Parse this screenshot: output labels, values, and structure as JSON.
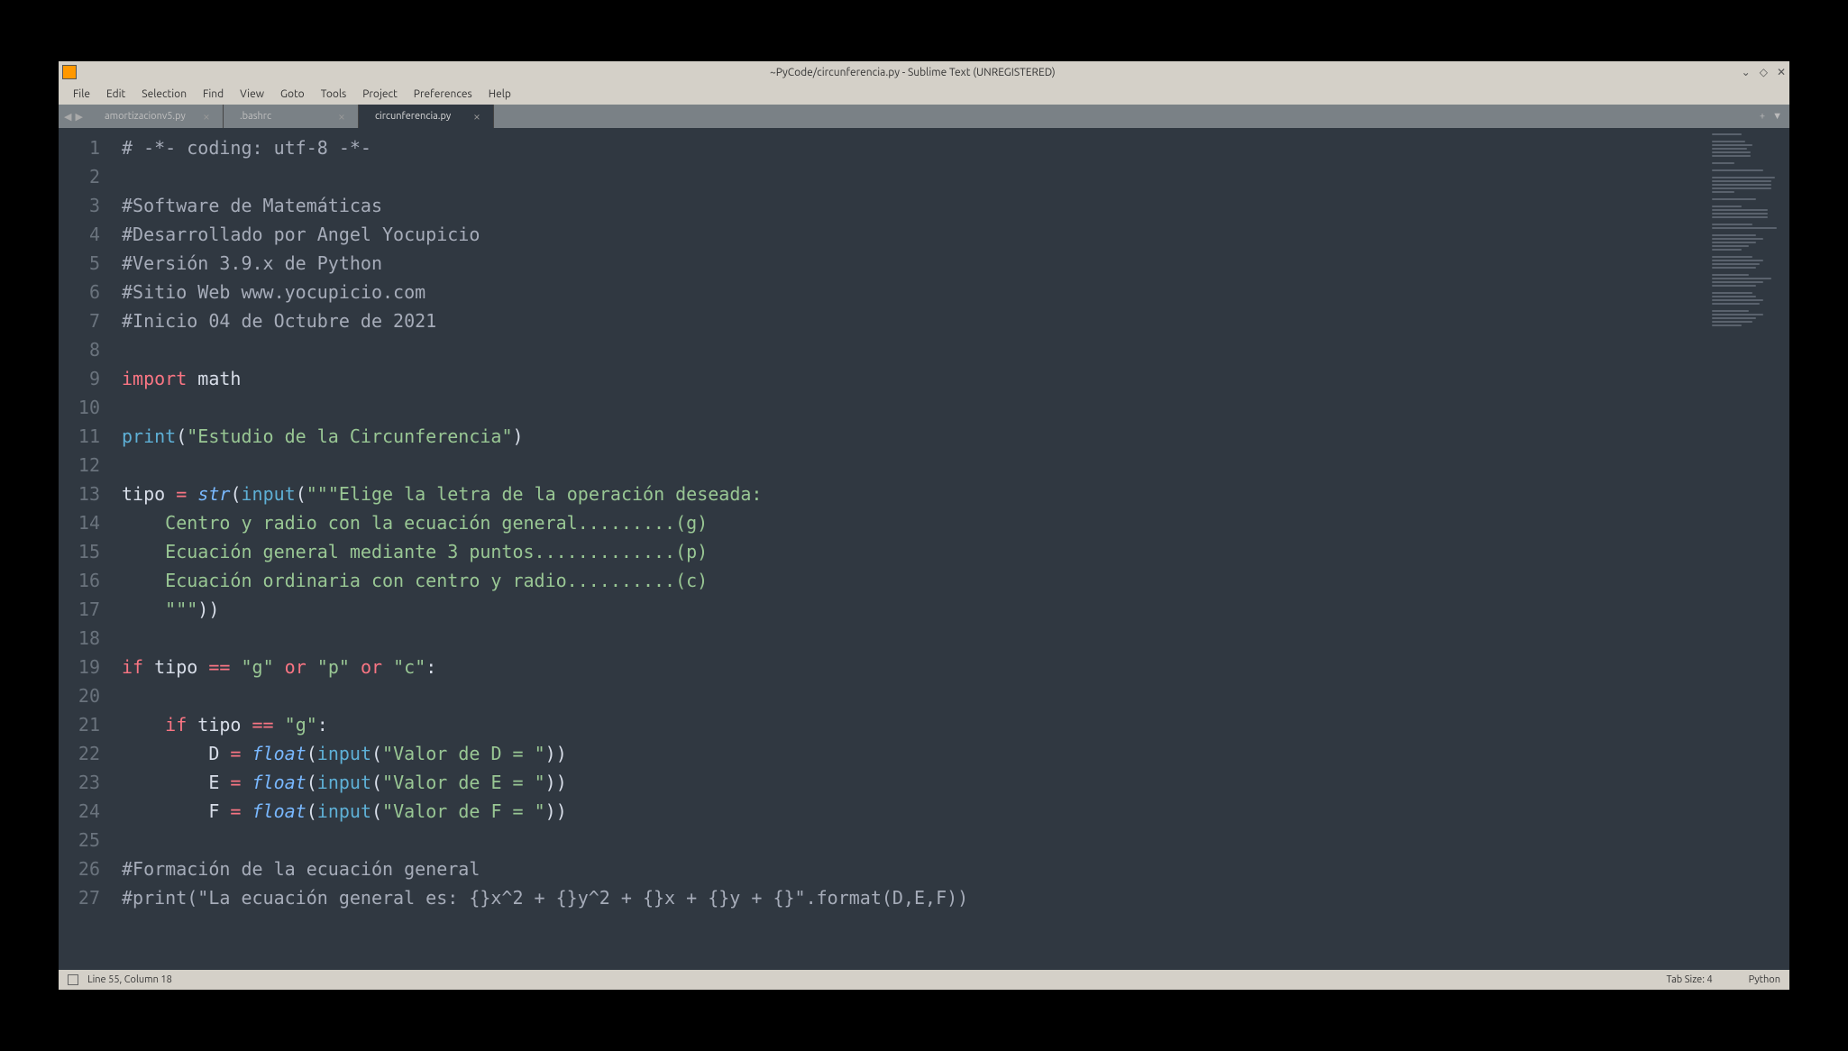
{
  "window": {
    "title": "~PyCode/circunferencia.py - Sublime Text (UNREGISTERED)"
  },
  "menu": {
    "items": [
      "File",
      "Edit",
      "Selection",
      "Find",
      "View",
      "Goto",
      "Tools",
      "Project",
      "Preferences",
      "Help"
    ]
  },
  "tabs": {
    "items": [
      {
        "label": "amortizacionv5.py",
        "active": false
      },
      {
        "label": ".bashrc",
        "active": false
      },
      {
        "label": "circunferencia.py",
        "active": true
      }
    ]
  },
  "statusbar": {
    "position": "Line 55, Column 18",
    "tab_size": "Tab Size: 4",
    "syntax": "Python"
  },
  "code": {
    "lines": [
      {
        "n": 1,
        "seg": [
          {
            "c": "comment",
            "t": "# -*- coding: utf-8 -*-"
          }
        ]
      },
      {
        "n": 2,
        "seg": []
      },
      {
        "n": 3,
        "seg": [
          {
            "c": "comment",
            "t": "#Software de Matemáticas"
          }
        ]
      },
      {
        "n": 4,
        "seg": [
          {
            "c": "comment",
            "t": "#Desarrollado por Angel Yocupicio"
          }
        ]
      },
      {
        "n": 5,
        "seg": [
          {
            "c": "comment",
            "t": "#Versión 3.9.x de Python"
          }
        ]
      },
      {
        "n": 6,
        "seg": [
          {
            "c": "comment",
            "t": "#Sitio Web www.yocupicio.com"
          }
        ]
      },
      {
        "n": 7,
        "seg": [
          {
            "c": "comment",
            "t": "#Inicio 04 de Octubre de 2021"
          }
        ]
      },
      {
        "n": 8,
        "seg": []
      },
      {
        "n": 9,
        "seg": [
          {
            "c": "kw",
            "t": "import"
          },
          {
            "c": "var",
            "t": " math"
          }
        ]
      },
      {
        "n": 10,
        "seg": []
      },
      {
        "n": 11,
        "seg": [
          {
            "c": "func",
            "t": "print"
          },
          {
            "c": "var",
            "t": "("
          },
          {
            "c": "string",
            "t": "\"Estudio de la Circunferencia\""
          },
          {
            "c": "var",
            "t": ")"
          }
        ]
      },
      {
        "n": 12,
        "seg": []
      },
      {
        "n": 13,
        "seg": [
          {
            "c": "var",
            "t": "tipo "
          },
          {
            "c": "op",
            "t": "="
          },
          {
            "c": "var",
            "t": " "
          },
          {
            "c": "builtin",
            "t": "str"
          },
          {
            "c": "var",
            "t": "("
          },
          {
            "c": "func",
            "t": "input"
          },
          {
            "c": "var",
            "t": "("
          },
          {
            "c": "string",
            "t": "\"\"\"Elige la letra de la operación deseada:"
          }
        ]
      },
      {
        "n": 14,
        "seg": [
          {
            "c": "string",
            "t": "    Centro y radio con la ecuación general.........(g)"
          }
        ]
      },
      {
        "n": 15,
        "seg": [
          {
            "c": "string",
            "t": "    Ecuación general mediante 3 puntos.............(p)"
          }
        ]
      },
      {
        "n": 16,
        "seg": [
          {
            "c": "string",
            "t": "    Ecuación ordinaria con centro y radio..........(c)"
          }
        ]
      },
      {
        "n": 17,
        "seg": [
          {
            "c": "string",
            "t": "    \"\"\""
          },
          {
            "c": "var",
            "t": "))"
          }
        ]
      },
      {
        "n": 18,
        "seg": []
      },
      {
        "n": 19,
        "seg": [
          {
            "c": "kw",
            "t": "if"
          },
          {
            "c": "var",
            "t": " tipo "
          },
          {
            "c": "op",
            "t": "=="
          },
          {
            "c": "var",
            "t": " "
          },
          {
            "c": "string",
            "t": "\"g\""
          },
          {
            "c": "var",
            "t": " "
          },
          {
            "c": "op",
            "t": "or"
          },
          {
            "c": "var",
            "t": " "
          },
          {
            "c": "string",
            "t": "\"p\""
          },
          {
            "c": "var",
            "t": " "
          },
          {
            "c": "op",
            "t": "or"
          },
          {
            "c": "var",
            "t": " "
          },
          {
            "c": "string",
            "t": "\"c\""
          },
          {
            "c": "var",
            "t": ":"
          }
        ]
      },
      {
        "n": 20,
        "seg": []
      },
      {
        "n": 21,
        "seg": [
          {
            "c": "var",
            "t": "    "
          },
          {
            "c": "kw",
            "t": "if"
          },
          {
            "c": "var",
            "t": " tipo "
          },
          {
            "c": "op",
            "t": "=="
          },
          {
            "c": "var",
            "t": " "
          },
          {
            "c": "string",
            "t": "\"g\""
          },
          {
            "c": "var",
            "t": ":"
          }
        ]
      },
      {
        "n": 22,
        "seg": [
          {
            "c": "var",
            "t": "        D "
          },
          {
            "c": "op",
            "t": "="
          },
          {
            "c": "var",
            "t": " "
          },
          {
            "c": "builtin",
            "t": "float"
          },
          {
            "c": "var",
            "t": "("
          },
          {
            "c": "func",
            "t": "input"
          },
          {
            "c": "var",
            "t": "("
          },
          {
            "c": "string",
            "t": "\"Valor de D = \""
          },
          {
            "c": "var",
            "t": "))"
          }
        ]
      },
      {
        "n": 23,
        "seg": [
          {
            "c": "var",
            "t": "        E "
          },
          {
            "c": "op",
            "t": "="
          },
          {
            "c": "var",
            "t": " "
          },
          {
            "c": "builtin",
            "t": "float"
          },
          {
            "c": "var",
            "t": "("
          },
          {
            "c": "func",
            "t": "input"
          },
          {
            "c": "var",
            "t": "("
          },
          {
            "c": "string",
            "t": "\"Valor de E = \""
          },
          {
            "c": "var",
            "t": "))"
          }
        ]
      },
      {
        "n": 24,
        "seg": [
          {
            "c": "var",
            "t": "        F "
          },
          {
            "c": "op",
            "t": "="
          },
          {
            "c": "var",
            "t": " "
          },
          {
            "c": "builtin",
            "t": "float"
          },
          {
            "c": "var",
            "t": "("
          },
          {
            "c": "func",
            "t": "input"
          },
          {
            "c": "var",
            "t": "("
          },
          {
            "c": "string",
            "t": "\"Valor de F = \""
          },
          {
            "c": "var",
            "t": "))"
          }
        ]
      },
      {
        "n": 25,
        "seg": []
      },
      {
        "n": 26,
        "seg": [
          {
            "c": "comment",
            "t": "#Formación de la ecuación general"
          }
        ]
      },
      {
        "n": 27,
        "seg": [
          {
            "c": "comment",
            "t": "#print(\"La ecuación general es: {}x^2 + {}y^2 + {}x + {}y + {}\".format(D,E,F))"
          }
        ]
      }
    ]
  },
  "minimap_widths": [
    40,
    0,
    45,
    55,
    48,
    52,
    52,
    0,
    30,
    0,
    70,
    0,
    85,
    80,
    80,
    80,
    30,
    0,
    60,
    0,
    40,
    75,
    75,
    75,
    0,
    55,
    88,
    0,
    60,
    70,
    60,
    50,
    40,
    0,
    55,
    70,
    65,
    60,
    0,
    50,
    80,
    70,
    60,
    0,
    55,
    60,
    70,
    65,
    0,
    50,
    70,
    60,
    55,
    40
  ]
}
